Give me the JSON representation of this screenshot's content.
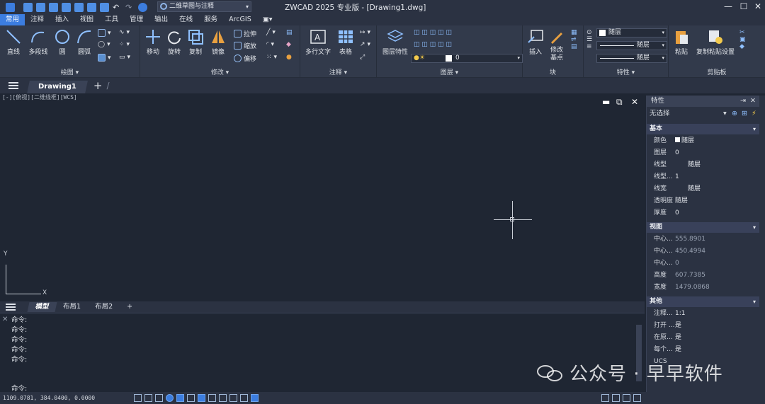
{
  "app": {
    "title": "ZWCAD 2025 专业版 - [Drawing1.dwg]",
    "workspace": "二维草图与注释"
  },
  "menu": [
    "常用",
    "注释",
    "插入",
    "视图",
    "工具",
    "管理",
    "输出",
    "在线",
    "服务",
    "ArcGIS"
  ],
  "ribbon": {
    "draw": {
      "label": "绘图",
      "line": "直线",
      "polyline": "多段线",
      "circle": "圆",
      "arc": "圆弧"
    },
    "modify": {
      "label": "修改",
      "move": "移动",
      "rotate": "旋转",
      "copy": "复制",
      "mirror": "镜像",
      "stretch": "拉伸",
      "scale": "缩放",
      "offset": "偏移"
    },
    "annotation": {
      "label": "注释",
      "mtext": "多行文字",
      "table": "表格"
    },
    "layers": {
      "label": "图层",
      "props": "图层特性",
      "current": "0"
    },
    "block": {
      "label": "块",
      "insert": "插入",
      "edit_base": "修改基点"
    },
    "properties": {
      "label": "特性",
      "color": "随层",
      "linetype": "随层",
      "lineweight": "随层"
    },
    "clipboard": {
      "label": "剪贴板",
      "paste": "粘贴",
      "copy_paste_settings": "复制粘贴设置"
    }
  },
  "doc_tab": "Drawing1",
  "viewport_label": "[-][俯视][二维线框][WCS]",
  "ucs": {
    "x": "X",
    "y": "Y"
  },
  "layout_tabs": [
    "模型",
    "布局1",
    "布局2"
  ],
  "command_lines": [
    "命令:",
    "命令:",
    "命令:",
    "命令:",
    "命令:"
  ],
  "command_prompt": "命令:",
  "coords": "1109.0781, 384.0400, 0.0000",
  "properties": {
    "title": "特性",
    "selection": "无选择",
    "sections": {
      "basic": "基本",
      "view": "视图",
      "misc": "其他"
    },
    "basic": [
      {
        "k": "颜色",
        "v": "随层"
      },
      {
        "k": "图层",
        "v": "0"
      },
      {
        "k": "线型",
        "v": "随层"
      },
      {
        "k": "线型...",
        "v": "1"
      },
      {
        "k": "线宽",
        "v": "随层"
      },
      {
        "k": "透明度",
        "v": "随层"
      },
      {
        "k": "厚度",
        "v": "0"
      }
    ],
    "view": [
      {
        "k": "中心...",
        "v": "555.8901"
      },
      {
        "k": "中心...",
        "v": "450.4994"
      },
      {
        "k": "中心...",
        "v": "0"
      },
      {
        "k": "高度",
        "v": "607.7385"
      },
      {
        "k": "宽度",
        "v": "1479.0868"
      }
    ],
    "misc": [
      {
        "k": "注释...",
        "v": "1:1"
      },
      {
        "k": "打开 ...",
        "v": "是"
      },
      {
        "k": "在原...",
        "v": "是"
      },
      {
        "k": "每个...",
        "v": "是"
      },
      {
        "k": "UCS",
        "v": ""
      }
    ]
  },
  "watermark": "公众号 · 早早软件",
  "colors": {
    "accent": "#3c7ddf",
    "bg": "#1f2633",
    "panel": "#323a4b"
  }
}
